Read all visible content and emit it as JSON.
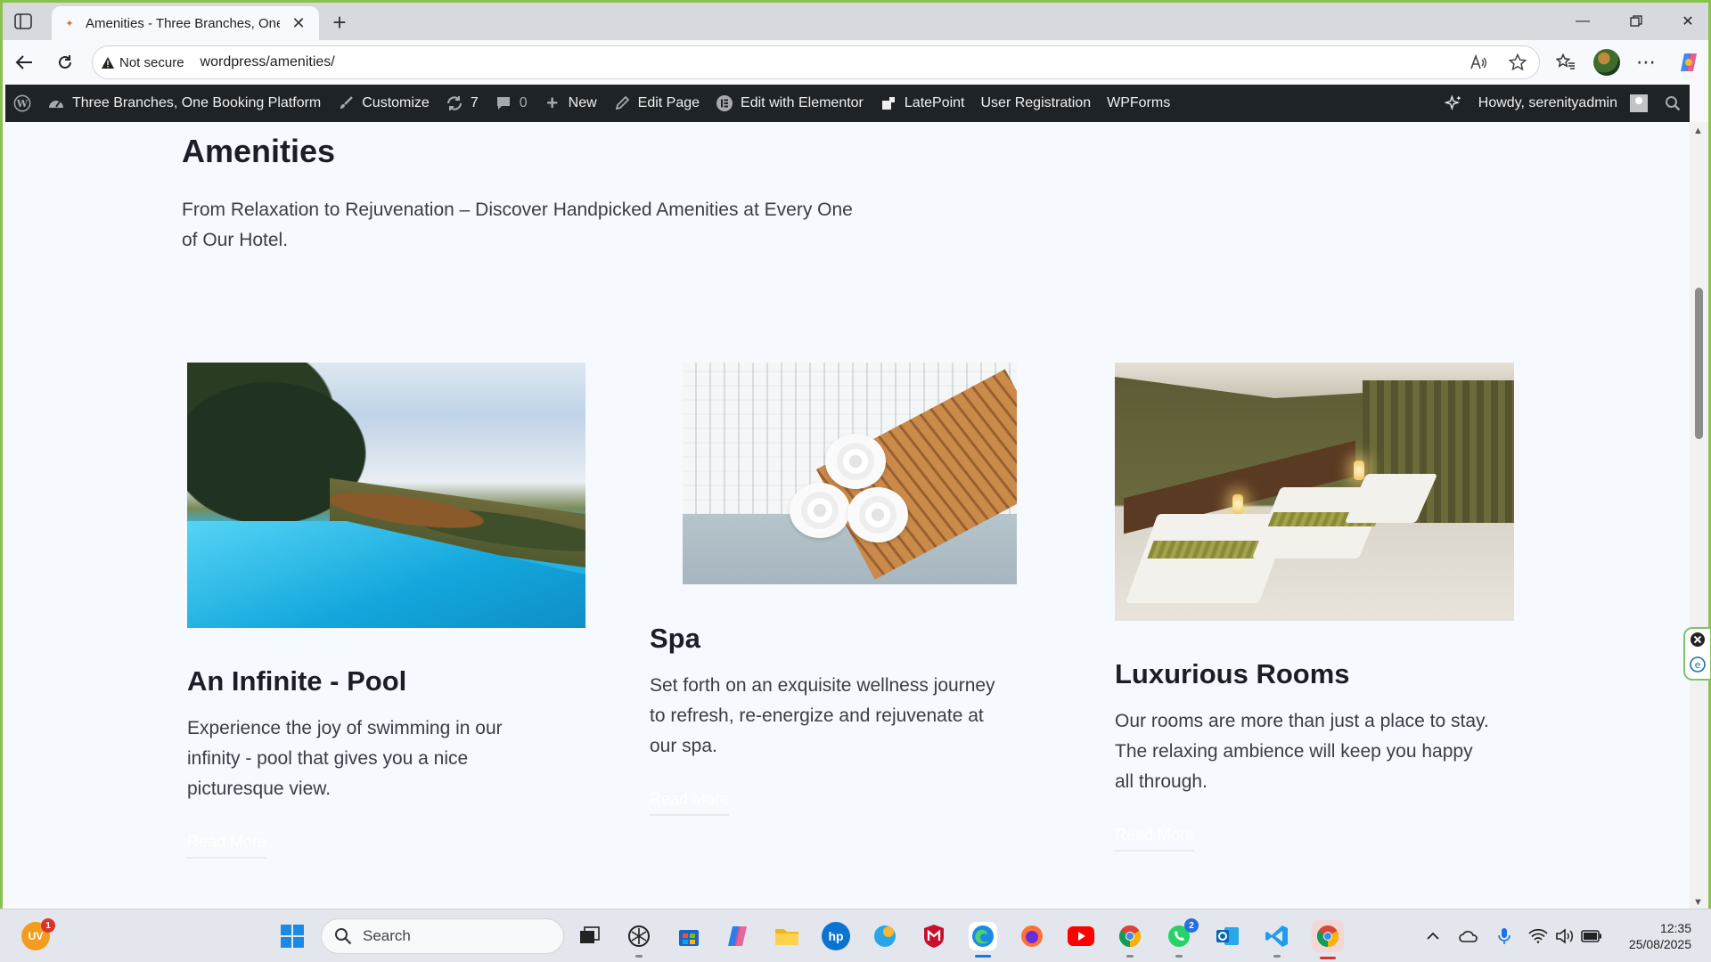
{
  "browser": {
    "tab_title": "Amenities - Three Branches, One Booking Platform",
    "security_label": "Not secure",
    "url": "wordpress/amenities/"
  },
  "adminbar": {
    "site_name": "Three Branches, One Booking Platform",
    "customize": "Customize",
    "updates_count": "7",
    "comments_count": "0",
    "new": "New",
    "edit_page": "Edit Page",
    "edit_elementor": "Edit with Elementor",
    "latepoint": "LatePoint",
    "user_registration": "User Registration",
    "wpforms": "WPForms",
    "howdy": "Howdy, serenityadmin"
  },
  "page": {
    "title": "Amenities",
    "intro": "From Relaxation to Rejuvenation – Discover Handpicked Amenities at Every One of Our Hotel."
  },
  "cards": [
    {
      "title": "An Infinite - Pool",
      "text": "Experience the joy of swimming in our infinity - pool that gives you a nice picturesque view.",
      "link": "Read More"
    },
    {
      "title": "Spa",
      "text": "Set forth on an exquisite wellness journey to refresh, re-energize and rejuvenate at our spa.",
      "link": "Read More"
    },
    {
      "title": "Luxurious Rooms",
      "text": "Our rooms are more than just a place to stay. The relaxing ambience will keep you happy all through.",
      "link": "Read More"
    }
  ],
  "taskbar": {
    "search_placeholder": "Search",
    "weather_badge": "1",
    "whatsapp_badge": "2",
    "time": "12:35",
    "date": "25/08/2025"
  },
  "colors": {
    "admin_bar": "#1d2327",
    "page_bg": "#f6f9fd",
    "window_border": "#8cc152",
    "text_dark": "#1b1e28"
  }
}
